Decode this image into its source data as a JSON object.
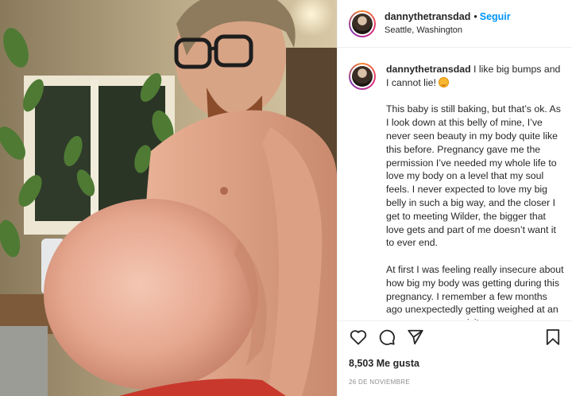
{
  "post": {
    "username": "dannythetransdad",
    "separator": "•",
    "follow_label": "Seguir",
    "location": "Seattle, Washington",
    "avatar_icon": "profile-avatar-icon"
  },
  "caption": {
    "username": "dannythetransdad",
    "first_line": "I like big bumps and I cannot lie!",
    "emoji_icon": "smiling-face-with-heart-eyes-icon",
    "paragraphs": [
      "This baby is still baking, but that’s ok. As I look down at this belly of mine, I’ve never seen beauty in my body quite like this before. Pregnancy gave me the permission I’ve needed my whole life to love my body on a level that my soul feels. I never expected to love my big belly in such a big way, and the closer I get to meeting Wilder, the bigger that love gets and part of me doesn’t want it to ever end.",
      "At first I was feeling really insecure about how big my body was getting during this pregnancy. I remember a few months ago unexpectedly getting weighed at an emergency room visit"
    ]
  },
  "actions": {
    "like_icon": "heart-icon",
    "comment_icon": "comment-icon",
    "share_icon": "share-icon",
    "save_icon": "bookmark-icon"
  },
  "likes_text": "8,503 Me gusta",
  "date_text": "26 DE NOVIEMBRE",
  "colors": {
    "follow": "#0095f6",
    "text": "#262626",
    "muted": "#8e8e8e",
    "divider": "#efefef"
  }
}
